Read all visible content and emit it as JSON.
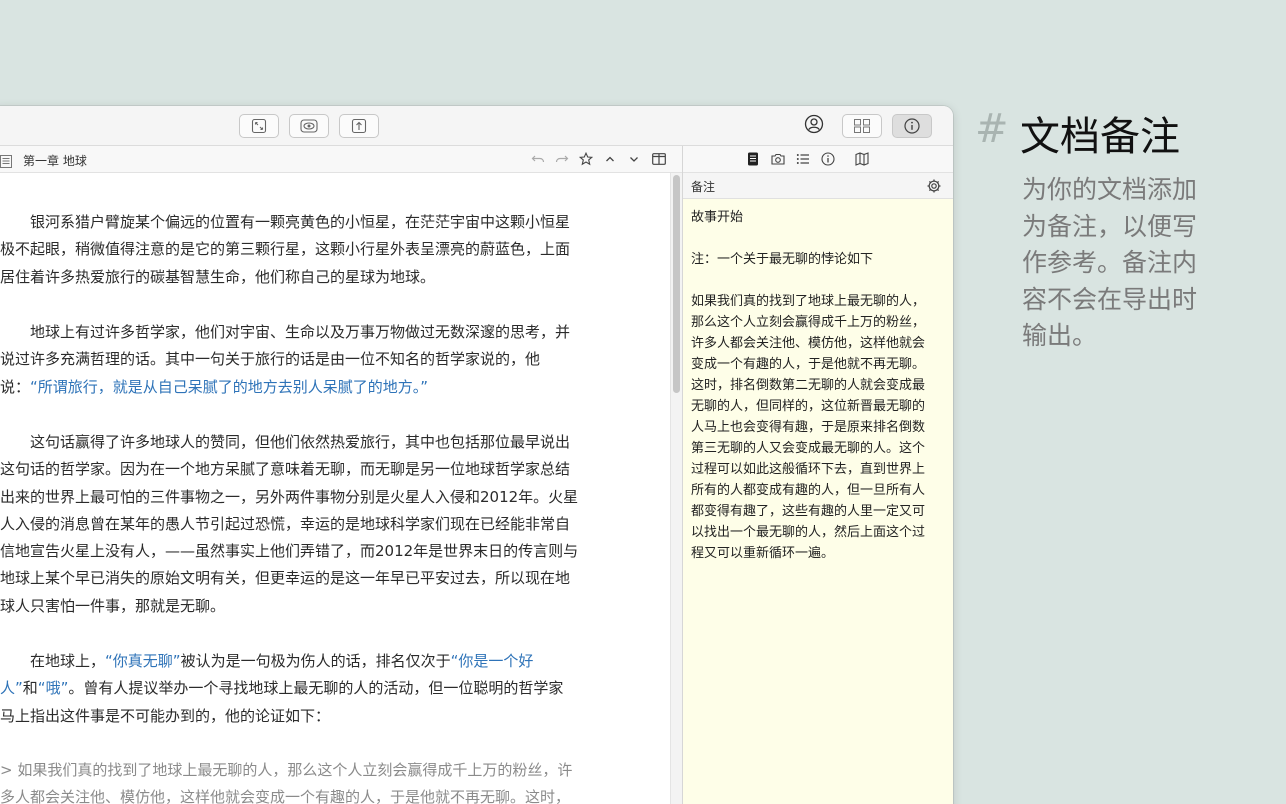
{
  "toolbar": {
    "buttons": [
      {
        "name": "expand-icon"
      },
      {
        "name": "preview-eye-icon"
      },
      {
        "name": "share-export-icon"
      },
      {
        "name": "account-icon"
      },
      {
        "name": "library-grid-icon"
      },
      {
        "name": "info-icon",
        "active": true
      }
    ]
  },
  "editor_bar": {
    "title": "第一章 地球",
    "icons": [
      "undo-icon",
      "redo-icon",
      "star-icon",
      "chevron-up-icon",
      "chevron-down-icon",
      "split-view-icon"
    ]
  },
  "editor": {
    "paragraphs": [
      {
        "lines": [
          "　　银河系猎户臂旋某个偏远的位置有一颗亮黄色的小恒星，在茫茫宇宙中这颗小恒星",
          "极不起眼，稍微值得注意的是它的第三颗行星，这颗小行星外表呈漂亮的蔚蓝色，上面",
          "居住着许多热爱旅行的碳基智慧生命，他们称自己的星球为地球。"
        ]
      },
      {
        "lines": [
          "　　地球上有过许多哲学家，他们对宇宙、生命以及万事万物做过无数深邃的思考，并",
          "说过许多充满哲理的话。其中一句关于旅行的话是由一位不知名的哲学家说的，他"
        ],
        "last_prefix": "说：",
        "last_highlight": "“所谓旅行，就是从自己呆腻了的地方去别人呆腻了的地方。”"
      },
      {
        "lines": [
          "　　这句话赢得了许多地球人的赞同，但他们依然热爱旅行，其中也包括那位最早说出",
          "这句话的哲学家。因为在一个地方呆腻了意味着无聊，而无聊是另一位地球哲学家总结",
          "出来的世界上最可怕的三件事物之一，另外两件事物分别是火星人入侵和2012年。火星",
          "人入侵的消息曾在某年的愚人节引起过恐慌，幸运的是地球科学家们现在已经能非常自",
          "信地宣告火星上没有人，——虽然事实上他们弄错了，而2012年是世界末日的传言则与",
          "地球上某个早已消失的原始文明有关，但更幸运的是这一年早已平安过去，所以现在地",
          "球人只害怕一件事，那就是无聊。"
        ]
      },
      {
        "line1_prefix": "　　在地球上，",
        "line1_hl": "“你真无聊”",
        "line1_mid": "被认为是一句极为伤人的话，排名仅次于",
        "line1_hl2": "“你是一个好",
        "line2_hl": "人”",
        "line2_mid": "和",
        "line2_hl2": "“哦”",
        "line2_rest": "。曾有人提议举办一个寻找地球上最无聊的人的活动，但一位聪明的哲学家",
        "line3": "马上指出这件事是不可能办到的，他的论证如下："
      },
      {
        "lines": [
          "> 如果我们真的找到了地球上最无聊的人，那么这个人立刻会赢得成千上万的粉丝，许",
          "多人都会关注他、模仿他，这样他就会变成一个有趣的人，于是他就不再无聊。这时，"
        ]
      }
    ]
  },
  "inspector": {
    "tabs": [
      "document-icon",
      "camera-icon",
      "list-icon",
      "info-circle-icon",
      "map-icon"
    ],
    "notes_label": "备注",
    "notes_lines": [
      "故事开始",
      "",
      "注：一个关于最无聊的悖论如下",
      "",
      "如果我们真的找到了地球上最无聊的人，",
      "那么这个人立刻会赢得成千上万的粉丝，",
      "许多人都会关注他、模仿他，这样他就会",
      "变成一个有趣的人，于是他就不再无聊。",
      "这时，排名倒数第二无聊的人就会变成最",
      "无聊的人，但同样的，这位新晋最无聊的",
      "人马上也会变得有趣，于是原来排名倒数",
      "第三无聊的人又会变成最无聊的人。这个",
      "过程可以如此这般循环下去，直到世界上",
      "所有的人都变成有趣的人，但一旦所有人",
      "都变得有趣了，这些有趣的人里一定又可",
      "以找出一个最无聊的人，然后上面这个过",
      "程又可以重新循环一遍。"
    ]
  },
  "feature": {
    "hash": "#",
    "title": "文档备注",
    "desc_lines": [
      "为你的文档添加",
      "为备注，以便写",
      "作参考。备注内",
      "容不会在导出时",
      "输出。"
    ]
  },
  "colors": {
    "background": "#d9e4e1",
    "highlight_text": "#2e73b8",
    "notes_background": "#fefee8",
    "quote_text": "#8b8b8b"
  }
}
